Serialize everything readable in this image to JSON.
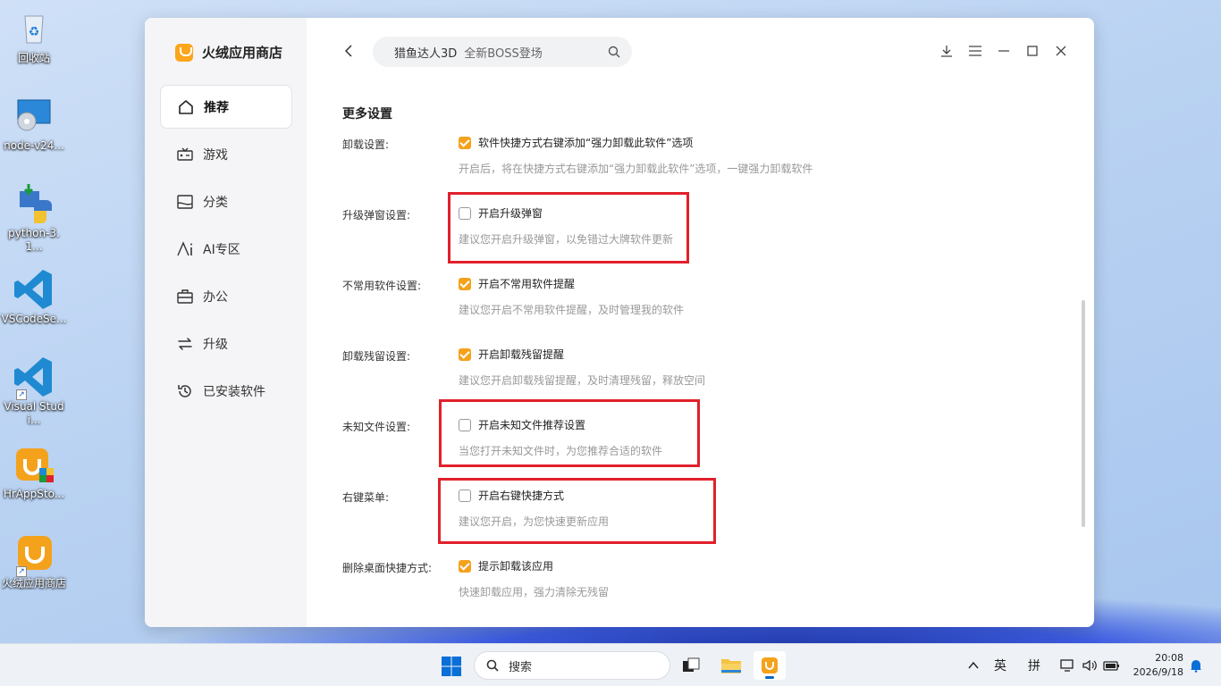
{
  "desktop": {
    "icons": [
      {
        "label": "回收站",
        "icon": "recycle-bin-icon"
      },
      {
        "label": "node-v24...",
        "icon": "node-installer-icon"
      },
      {
        "label": "python-3.1...",
        "icon": "python-installer-icon"
      },
      {
        "label": "VSCodeSe...",
        "icon": "vscode-icon"
      },
      {
        "label": "Visual Studi...",
        "icon": "vscode-icon"
      },
      {
        "label": "HrAppSto...",
        "icon": "hrappstore-installer-icon"
      },
      {
        "label": "火绒应用商店",
        "icon": "huorong-store-icon"
      }
    ]
  },
  "app": {
    "name": "火绒应用商店",
    "accent_color": "#f4a21c",
    "nav": [
      {
        "label": "推荐",
        "icon": "home-icon",
        "active": true
      },
      {
        "label": "游戏",
        "icon": "game-icon",
        "active": false
      },
      {
        "label": "分类",
        "icon": "category-icon",
        "active": false
      },
      {
        "label": "AI专区",
        "icon": "ai-icon",
        "active": false
      },
      {
        "label": "办公",
        "icon": "briefcase-icon",
        "active": false
      },
      {
        "label": "升级",
        "icon": "refresh-icon",
        "active": false
      },
      {
        "label": "已安装软件",
        "icon": "history-icon",
        "active": false
      }
    ],
    "search": {
      "keyword": "猎鱼达人3D",
      "hint": "全新BOSS登场"
    }
  },
  "settings": {
    "title": "更多设置",
    "rows": [
      {
        "label": "卸载设置:",
        "option": "软件快捷方式右键添加“强力卸载此软件”选项",
        "checked": true,
        "desc": "开启后，将在快捷方式右键添加“强力卸载此软件”选项，一键强力卸载软件"
      },
      {
        "label": "升级弹窗设置:",
        "option": "开启升级弹窗",
        "checked": false,
        "desc": "建议您开启升级弹窗，以免错过大牌软件更新"
      },
      {
        "label": "不常用软件设置:",
        "option": "开启不常用软件提醒",
        "checked": true,
        "desc": "建议您开启不常用软件提醒，及时管理我的软件"
      },
      {
        "label": "卸载残留设置:",
        "option": "开启卸载残留提醒",
        "checked": true,
        "desc": "建议您开启卸载残留提醒，及时清理残留，释放空间"
      },
      {
        "label": "未知文件设置:",
        "option": "开启未知文件推荐设置",
        "checked": false,
        "desc": "当您打开未知文件时，为您推荐合适的软件"
      },
      {
        "label": "右键菜单:",
        "option": "开启右键快捷方式",
        "checked": false,
        "desc": "建议您开启，为您快速更新应用"
      },
      {
        "label": "删除桌面快捷方式:",
        "option": "提示卸载该应用",
        "checked": true,
        "desc": "快速卸载应用，强力清除无残留"
      }
    ]
  },
  "taskbar": {
    "search_label": "搜索",
    "tray": {
      "lang": "英",
      "ime": "拼"
    },
    "time": "20:08",
    "date": "2026/9/18"
  }
}
